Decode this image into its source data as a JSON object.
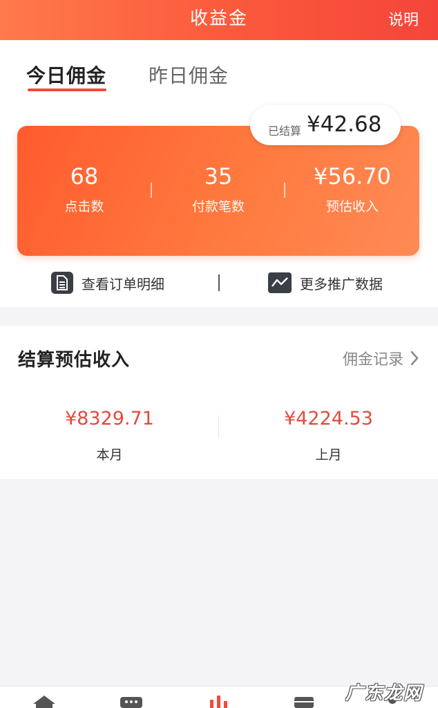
{
  "header": {
    "title": "收益金",
    "help_label": "说明"
  },
  "tabs": {
    "today": "今日佣金",
    "yesterday": "昨日佣金"
  },
  "settled": {
    "label": "已结算",
    "value": "¥42.68"
  },
  "stats": [
    {
      "value": "68",
      "label": "点击数"
    },
    {
      "value": "35",
      "label": "付款笔数"
    },
    {
      "value": "¥56.70",
      "label": "预估收入"
    }
  ],
  "links": {
    "orders": "查看订单明细",
    "more_data": "更多推广数据"
  },
  "income": {
    "title": "结算预估收入",
    "record_link": "佣金记录",
    "this_month": {
      "amount": "¥8329.71",
      "label": "本月"
    },
    "last_month": {
      "amount": "¥4224.53",
      "label": "上月"
    }
  },
  "watermark": "广东龙网",
  "colors": {
    "accent": "#f5493b",
    "amount_red": "#e14b3c"
  },
  "icons": [
    "document-icon",
    "chart-line-icon",
    "chevron-right-icon",
    "home-icon",
    "more-icon",
    "bar-chart-icon",
    "shop-icon",
    "user-icon"
  ]
}
